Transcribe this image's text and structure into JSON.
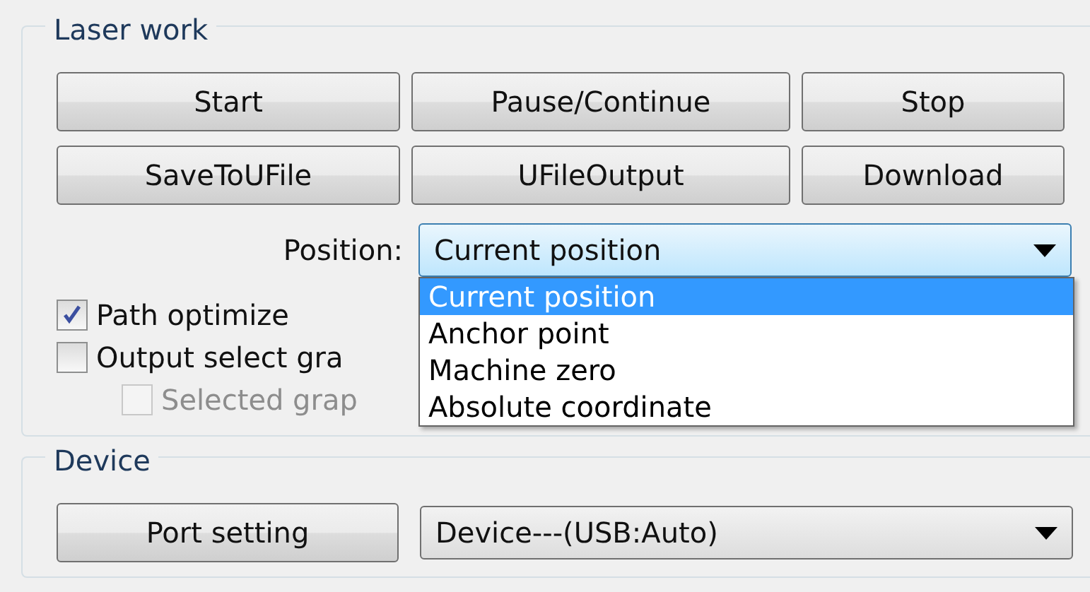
{
  "laser_work": {
    "title": "Laser work",
    "buttons": [
      "Start",
      "Pause/Continue",
      "Stop",
      "SaveToUFile",
      "UFileOutput",
      "Download"
    ],
    "position": {
      "label": "Position:",
      "value": "Current position",
      "expanded": true,
      "options": [
        {
          "label": "Current position",
          "selected": true
        },
        {
          "label": "Anchor point",
          "selected": false
        },
        {
          "label": "Machine zero",
          "selected": false
        },
        {
          "label": "Absolute coordinate",
          "selected": false
        }
      ]
    },
    "checkboxes": [
      {
        "label": "Path optimize",
        "checked": true,
        "disabled": false,
        "indented": false
      },
      {
        "label": "Output select gra",
        "checked": false,
        "disabled": false,
        "indented": false
      },
      {
        "label": "Selected grap",
        "checked": false,
        "disabled": true,
        "indented": true
      }
    ]
  },
  "device": {
    "title": "Device",
    "button": "Port setting",
    "value": "Device---(USB:Auto)"
  }
}
